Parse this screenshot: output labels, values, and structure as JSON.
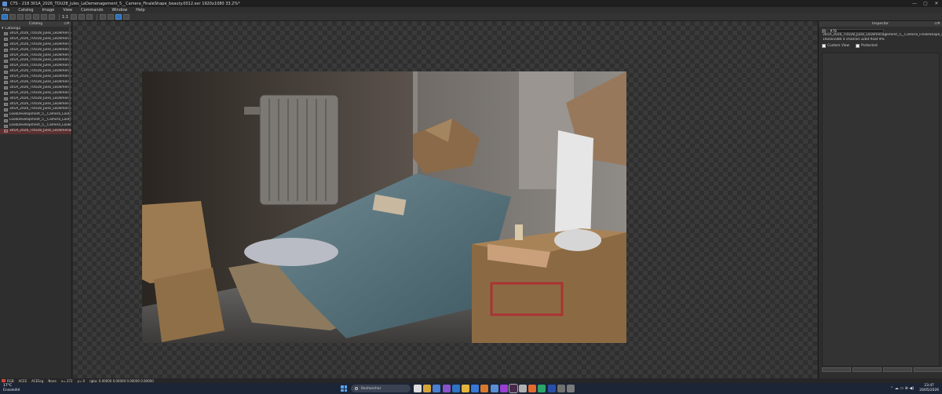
{
  "window": {
    "title": "CTS - 218 301A_2026_TOU28_Jules_LeDemenagement_5__Camera_FinaleShape_beauty.0012.exr 1920x1080 33.2%*",
    "controls": [
      "—",
      "▢",
      "✕"
    ]
  },
  "menu": [
    "File",
    "Catalog",
    "Image",
    "View",
    "Commands",
    "Window",
    "Help"
  ],
  "toolbar": {
    "zoom_label": "1:1"
  },
  "catalog": {
    "header": "Catalog",
    "root": "Catalog1",
    "items": [
      "301A_2026_TOU28_Jules_LeDemenagement",
      "301A_2026_TOU28_Jules_LeDemenagement",
      "301A_2026_TOU28_Jules_LeDemenagement",
      "301A_2026_TOU28_Jules_LeDemenagement",
      "301A_2026_TOU28_Jules_LeDemenagement",
      "301A_2026_TOU28_Jules_LeDemenagement",
      "301A_2026_TOU28_Jules_LeDemenagement",
      "301A_2026_TOU28_Jules_LeDemenagement",
      "301A_2026_TOU28_Jules_LeDemenagement",
      "301A_2026_TOU28_Jules_LeDemenagement",
      "301A_2026_TOU28_Jules_LeDemenagement",
      "301A_2026_TOU28_Jules_LeDemenagement",
      "301A_2026_TOU28_Jules_LeDemenagement",
      "301A_2026_TOU28_Jules_LeDemenagement",
      "301A_2026_TOU28_Jules_LeDemenagement",
      "LookDevelopment_5__Camera_LookdevSh",
      "LookDevelopment_5__Camera_LookdevSh",
      "LookDevelopment_5__Camera_LookdevSh",
      "301A_2026_TOU28_Jules_LeDemenagement"
    ],
    "selected_index": 18
  },
  "inspector": {
    "header": "Inspector",
    "name_value": "#78",
    "file": "301A_2026_TOU28_Jules_LeDemenagement_5__Camera_FinaleShape_beauty.0012.exr",
    "info": "1920x1080 4 channel 32bit float 9%",
    "check_custom": "Custom View",
    "check_protected": "Protected"
  },
  "statusbar": {
    "items": [
      "RGB",
      "ACES",
      "ACEScg",
      "None",
      "x= 272",
      "y= 0",
      "rgba: 0.00000  0.00000  0.00000  0.00000"
    ]
  },
  "taskbar": {
    "weather_temp": "17°C",
    "weather_desc": "Ensoleillé",
    "search_placeholder": "Rechercher",
    "time": "23:47",
    "date": "20/05/2026",
    "sys_icons": "⌃  ☁  ▭  ⊕  ◀)"
  },
  "colors": {
    "accent": "#2f6fb5",
    "selection": "#5a3030"
  }
}
